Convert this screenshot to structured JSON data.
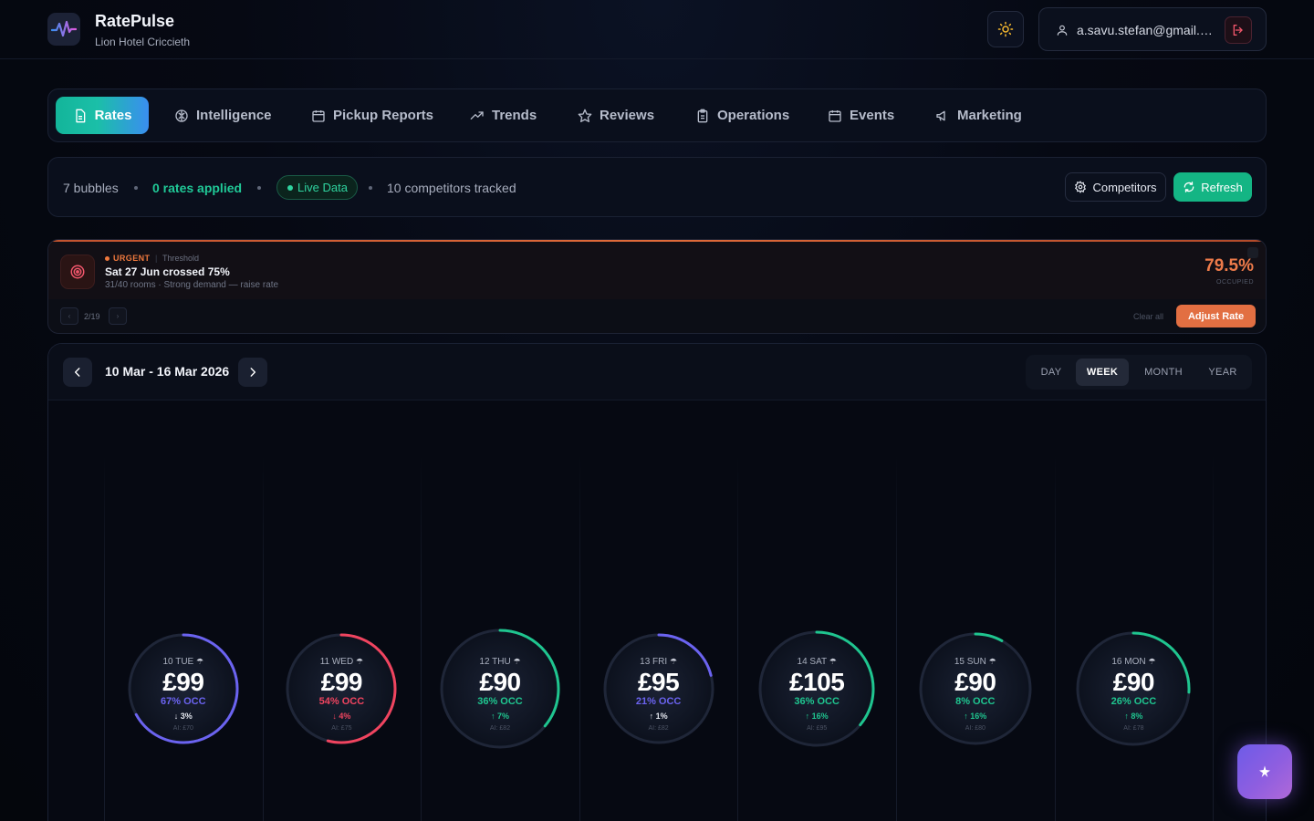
{
  "app": {
    "title": "RatePulse",
    "hotel": "Lion Hotel Criccieth"
  },
  "user": {
    "email": "a.savu.stefan@gmail.com"
  },
  "tabs": [
    {
      "label": "Rates",
      "icon": "file-icon",
      "active": true
    },
    {
      "label": "Intelligence",
      "icon": "brain-icon"
    },
    {
      "label": "Pickup Reports",
      "icon": "calendar-icon"
    },
    {
      "label": "Trends",
      "icon": "trend-up-icon"
    },
    {
      "label": "Reviews",
      "icon": "star-icon"
    },
    {
      "label": "Operations",
      "icon": "clipboard-icon"
    },
    {
      "label": "Events",
      "icon": "calendar-icon"
    },
    {
      "label": "Marketing",
      "icon": "megaphone-icon"
    }
  ],
  "status": {
    "bubbles": "7 bubbles",
    "rates_applied": "0 rates applied",
    "live": "Live Data",
    "competitors_tracked": "10 competitors tracked",
    "competitors_button": "Competitors",
    "refresh_button": "Refresh"
  },
  "alert": {
    "severity": "URGENT",
    "type": "Threshold",
    "title": "Sat 27 Jun crossed 75%",
    "description": "31/40 rooms · Strong demand — raise rate",
    "percent": "79.5%",
    "percent_label": "OCCUPIED",
    "pager": "2/19",
    "clear_all": "Clear all",
    "action": "Adjust Rate"
  },
  "calendar": {
    "range": "10 Mar - 16 Mar 2026",
    "views": [
      "DAY",
      "WEEK",
      "MONTH",
      "YEAR"
    ],
    "active_view": "WEEK",
    "days": [
      {
        "day": "10 TUE",
        "price": "£99",
        "occ": "67% OCC",
        "occ_value": 67,
        "change": "↓ 3%",
        "ai": "AI: £70",
        "color": "#6b63f0",
        "change_color": "#e3e6ee"
      },
      {
        "day": "11 WED",
        "price": "£99",
        "occ": "54% OCC",
        "occ_value": 54,
        "change": "↓ 4%",
        "ai": "AI: £75",
        "color": "#f0445f",
        "change_color": "#f0445f"
      },
      {
        "day": "12 THU",
        "price": "£90",
        "occ": "36% OCC",
        "occ_value": 36,
        "change": "↑ 7%",
        "ai": "AI: £82",
        "color": "#1fc58f",
        "change_color": "#1fc58f"
      },
      {
        "day": "13 FRI",
        "price": "£95",
        "occ": "21% OCC",
        "occ_value": 21,
        "change": "↑ 1%",
        "ai": "AI: £82",
        "color": "#6b63f0",
        "change_color": "#e3e6ee"
      },
      {
        "day": "14 SAT",
        "price": "£105",
        "occ": "36% OCC",
        "occ_value": 36,
        "change": "↑ 16%",
        "ai": "AI: £95",
        "color": "#1fc58f",
        "change_color": "#1fc58f"
      },
      {
        "day": "15 SUN",
        "price": "£90",
        "occ": "8% OCC",
        "occ_value": 8,
        "change": "↑ 16%",
        "ai": "AI: £80",
        "color": "#1fc58f",
        "change_color": "#1fc58f"
      },
      {
        "day": "16 MON",
        "price": "£90",
        "occ": "26% OCC",
        "occ_value": 26,
        "change": "↑ 8%",
        "ai": "AI: £78",
        "color": "#1fc58f",
        "change_color": "#1fc58f"
      }
    ]
  },
  "colors": {
    "accent_green": "#14b584",
    "accent_orange": "#e26f42",
    "accent_purple": "#6b63f0"
  }
}
